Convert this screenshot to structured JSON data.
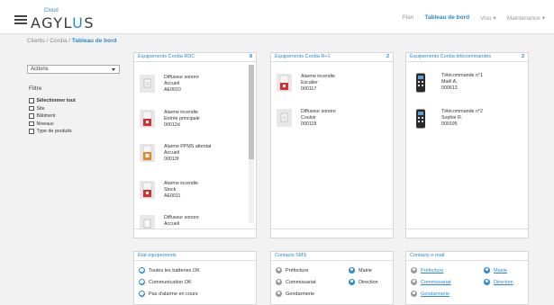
{
  "header": {
    "logo_cloud": "Cloud",
    "logo_text_pre": "AGYL",
    "logo_text_u": "U",
    "logo_text_post": "S",
    "nav": [
      "Plan",
      "Tableau de bord",
      "Visu ▾",
      "Maintenance ▾"
    ]
  },
  "breadcrumb": {
    "clients": "Clients",
    "sep1": " / ",
    "cordia": "Cordia",
    "sep2": " / ",
    "current": "Tableau de bord"
  },
  "sidebar": {
    "actions_label": "Actions",
    "filtre_label": "Filtre",
    "filters": [
      "Sélectionner tout",
      "Site",
      "Bâtiment",
      "Niveaux",
      "Type de produits"
    ]
  },
  "panels": {
    "rdc": {
      "title": "Équipements Cordia RDC",
      "count": "8",
      "items": [
        {
          "name": "Diffuseur sonore",
          "loc": "Accueil",
          "code": "AE0010"
        },
        {
          "name": "Alarme incendie",
          "loc": "Entrée principale",
          "code": "00012d"
        },
        {
          "name": "Alarme PPMS attentat",
          "loc": "Accueil",
          "code": "00013f"
        },
        {
          "name": "Alarme incendie",
          "loc": "Stock",
          "code": "AE0011"
        },
        {
          "name": "Diffuseur sonore",
          "loc": "Accueil",
          "code": ""
        }
      ]
    },
    "r1": {
      "title": "Équipements Cordia R+1",
      "count": "2",
      "items": [
        {
          "name": "Alarme incendie",
          "loc": "Escalier",
          "code": "000117"
        },
        {
          "name": "Diffuseur sonore",
          "loc": "Couloir",
          "code": "000118"
        }
      ]
    },
    "tele": {
      "title": "Équipements Cordia télécommandes",
      "count": "2",
      "items": [
        {
          "name": "Télécommande n°1",
          "loc": "Maël A.",
          "code": "000613"
        },
        {
          "name": "Télécommande n°2",
          "loc": "Sophie R.",
          "code": "000195"
        }
      ]
    },
    "etat": {
      "title": "État équipements",
      "rows": [
        "Toutes les batteries OK",
        "Communication OK",
        "Pas d'alarme en cours"
      ]
    },
    "sms": {
      "title": "Contacts SMS",
      "left": [
        "Préfecture",
        "Commissariat",
        "Gendarmerie"
      ],
      "right": [
        "Mairie",
        "Direction"
      ]
    },
    "email": {
      "title": "Contacts e-mail",
      "left": [
        "Préfecture",
        "Commissariat",
        "Gendarmerie"
      ],
      "right": [
        "Mairie",
        "Direction"
      ]
    }
  },
  "colors": {
    "accent": "#2a8bd2",
    "alarm_red": "#d9302f",
    "ppms_orange": "#e8872a"
  }
}
